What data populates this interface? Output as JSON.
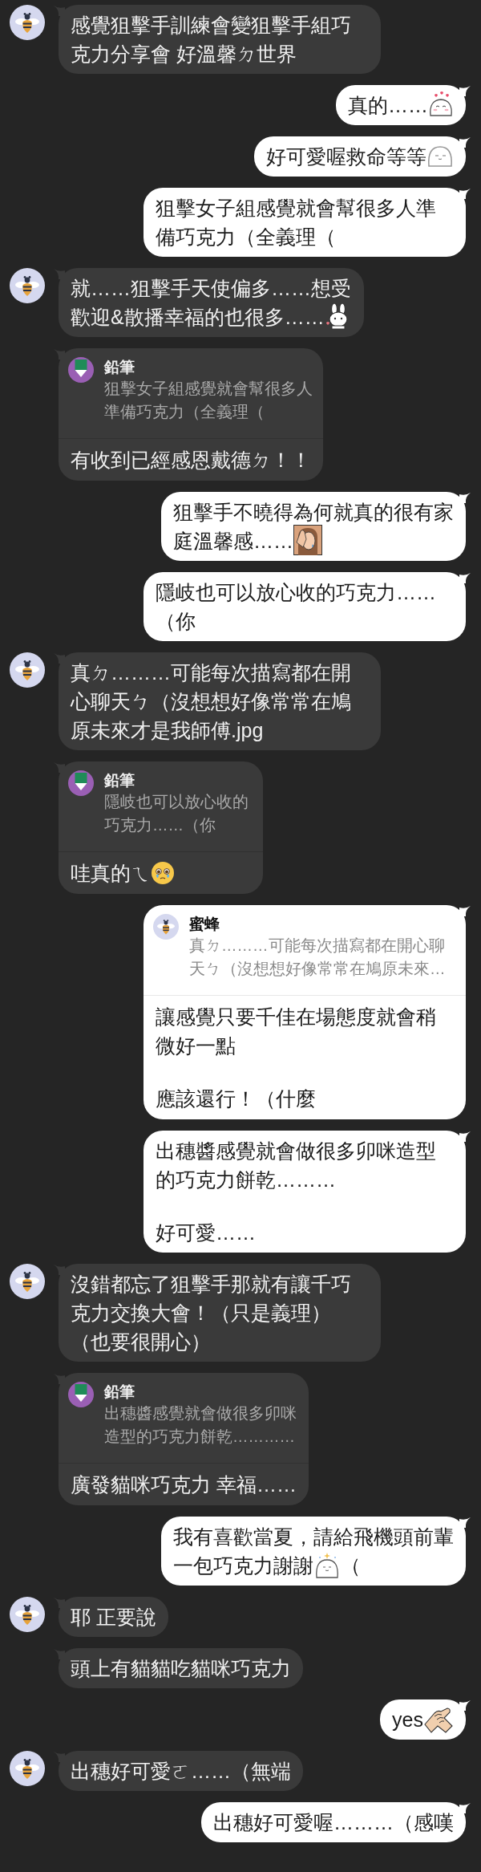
{
  "messages": [
    {
      "kind": "incoming",
      "avatar": true,
      "blocks": [
        {
          "kind": "line",
          "parts": [
            {
              "kind": "text",
              "text": "感覺狙擊手訓練會變狙擊手組巧克力分享會 好溫馨ㄉ世界"
            }
          ]
        }
      ]
    },
    {
      "kind": "outgoing",
      "blocks": [
        {
          "kind": "line",
          "parts": [
            {
              "kind": "text",
              "text": "真的……"
            },
            {
              "kind": "blobhearts"
            }
          ]
        }
      ]
    },
    {
      "kind": "outgoing",
      "blocks": [
        {
          "kind": "line",
          "parts": [
            {
              "kind": "text",
              "text": "好可愛喔救命等等"
            },
            {
              "kind": "blobsmile"
            }
          ]
        }
      ]
    },
    {
      "kind": "outgoing",
      "blocks": [
        {
          "kind": "line",
          "parts": [
            {
              "kind": "text",
              "text": "狙擊女子組感覺就會幫很多人準備巧克力（全義理（"
            }
          ]
        }
      ]
    },
    {
      "kind": "incoming",
      "avatar": true,
      "blocks": [
        {
          "kind": "line",
          "parts": [
            {
              "kind": "text",
              "text": "就……狙擊手天使偏多……想受"
            }
          ]
        },
        {
          "kind": "line",
          "parts": [
            {
              "kind": "text",
              "text": "歡迎&散播幸福的也很多……"
            },
            {
              "kind": "rabbit"
            }
          ]
        }
      ]
    },
    {
      "kind": "incoming",
      "avatar": false,
      "quote": {
        "kind": "pencil",
        "name": "鉛筆",
        "text": "狙擊女子組感覺就會幫很多人準備巧克力（全義理（"
      },
      "blocks": [
        {
          "kind": "line",
          "parts": [
            {
              "kind": "text",
              "text": "有收到已經感恩戴德ㄉ！！"
            }
          ]
        }
      ]
    },
    {
      "kind": "outgoing",
      "blocks": [
        {
          "kind": "line",
          "parts": [
            {
              "kind": "text",
              "text": "狙擊手不曉得為何就真的很有家"
            }
          ]
        },
        {
          "kind": "line",
          "parts": [
            {
              "kind": "text",
              "text": "庭溫馨感……"
            },
            {
              "kind": "facepalm"
            }
          ]
        }
      ]
    },
    {
      "kind": "outgoing",
      "blocks": [
        {
          "kind": "line",
          "parts": [
            {
              "kind": "text",
              "text": "隱岐也可以放心收的巧克力……（你"
            }
          ]
        }
      ]
    },
    {
      "kind": "incoming",
      "avatar": true,
      "blocks": [
        {
          "kind": "line",
          "parts": [
            {
              "kind": "text",
              "text": "真ㄉ………可能每次描寫都在開心聊天ㄅ（沒想想好像常常在鳩原未來才是我師傅.jpg"
            }
          ]
        }
      ]
    },
    {
      "kind": "incoming",
      "avatar": false,
      "quote": {
        "kind": "pencil",
        "name": "鉛筆",
        "text": "隱岐也可以放心收的巧克力……（你"
      },
      "blocks": [
        {
          "kind": "line",
          "parts": [
            {
              "kind": "text",
              "text": "哇真的ㄟ"
            },
            {
              "kind": "teary"
            }
          ]
        }
      ]
    },
    {
      "kind": "outgoing",
      "quote": {
        "kind": "bee",
        "name": "蜜蜂",
        "text": "真ㄉ………可能每次描寫都在開心聊天ㄅ（沒想想好像常常在鳩原未來…"
      },
      "blocks": [
        {
          "kind": "line",
          "parts": [
            {
              "kind": "text",
              "text": "讓感覺只要千佳在場態度就會稍微好一點"
            }
          ]
        },
        {
          "kind": "paragraph",
          "parts": [
            {
              "kind": "text",
              "text": "應該還行！（什麼"
            }
          ]
        }
      ]
    },
    {
      "kind": "outgoing",
      "blocks": [
        {
          "kind": "line",
          "parts": [
            {
              "kind": "text",
              "text": "出穗醬感覺就會做很多卯咪造型的巧克力餅乾………"
            }
          ]
        },
        {
          "kind": "paragraph",
          "parts": [
            {
              "kind": "text",
              "text": "好可愛……"
            }
          ]
        }
      ]
    },
    {
      "kind": "incoming",
      "avatar": true,
      "blocks": [
        {
          "kind": "line",
          "parts": [
            {
              "kind": "text",
              "text": "沒錯都忘了狙擊手那就有讓千巧克力交換大會！（只是義理）（也要很開心）"
            }
          ]
        }
      ]
    },
    {
      "kind": "incoming",
      "avatar": false,
      "quote": {
        "kind": "pencil",
        "name": "鉛筆",
        "text": "出穗醬感覺就會做很多卯咪造型的巧克力餅乾…………"
      },
      "blocks": [
        {
          "kind": "line",
          "parts": [
            {
              "kind": "text",
              "text": "廣發貓咪巧克力 幸福……"
            }
          ]
        }
      ]
    },
    {
      "kind": "outgoing",
      "blocks": [
        {
          "kind": "line",
          "parts": [
            {
              "kind": "text",
              "text": "我有喜歡當夏，請給飛機頭前輩"
            }
          ]
        },
        {
          "kind": "line",
          "parts": [
            {
              "kind": "text",
              "text": "一包巧克力謝謝"
            },
            {
              "kind": "blobsparkle"
            },
            {
              "kind": "text",
              "text": "（"
            }
          ]
        }
      ]
    },
    {
      "kind": "incoming",
      "avatar": true,
      "blocks": [
        {
          "kind": "line",
          "parts": [
            {
              "kind": "text",
              "text": "耶 正要說"
            }
          ]
        }
      ]
    },
    {
      "kind": "incoming",
      "avatar": false,
      "blocks": [
        {
          "kind": "line",
          "parts": [
            {
              "kind": "text",
              "text": "頭上有貓貓吃貓咪巧克力"
            }
          ]
        }
      ]
    },
    {
      "kind": "outgoing",
      "blocks": [
        {
          "kind": "line",
          "parts": [
            {
              "kind": "text",
              "text": "yes"
            },
            {
              "kind": "handshake"
            }
          ]
        }
      ]
    },
    {
      "kind": "incoming",
      "avatar": true,
      "blocks": [
        {
          "kind": "line",
          "parts": [
            {
              "kind": "text",
              "text": "出穗好可愛ㄛ……（無端"
            }
          ]
        }
      ]
    },
    {
      "kind": "outgoing",
      "blocks": [
        {
          "kind": "line",
          "parts": [
            {
              "kind": "text",
              "text": "出穗好可愛喔………（感嘆"
            }
          ]
        }
      ]
    }
  ]
}
